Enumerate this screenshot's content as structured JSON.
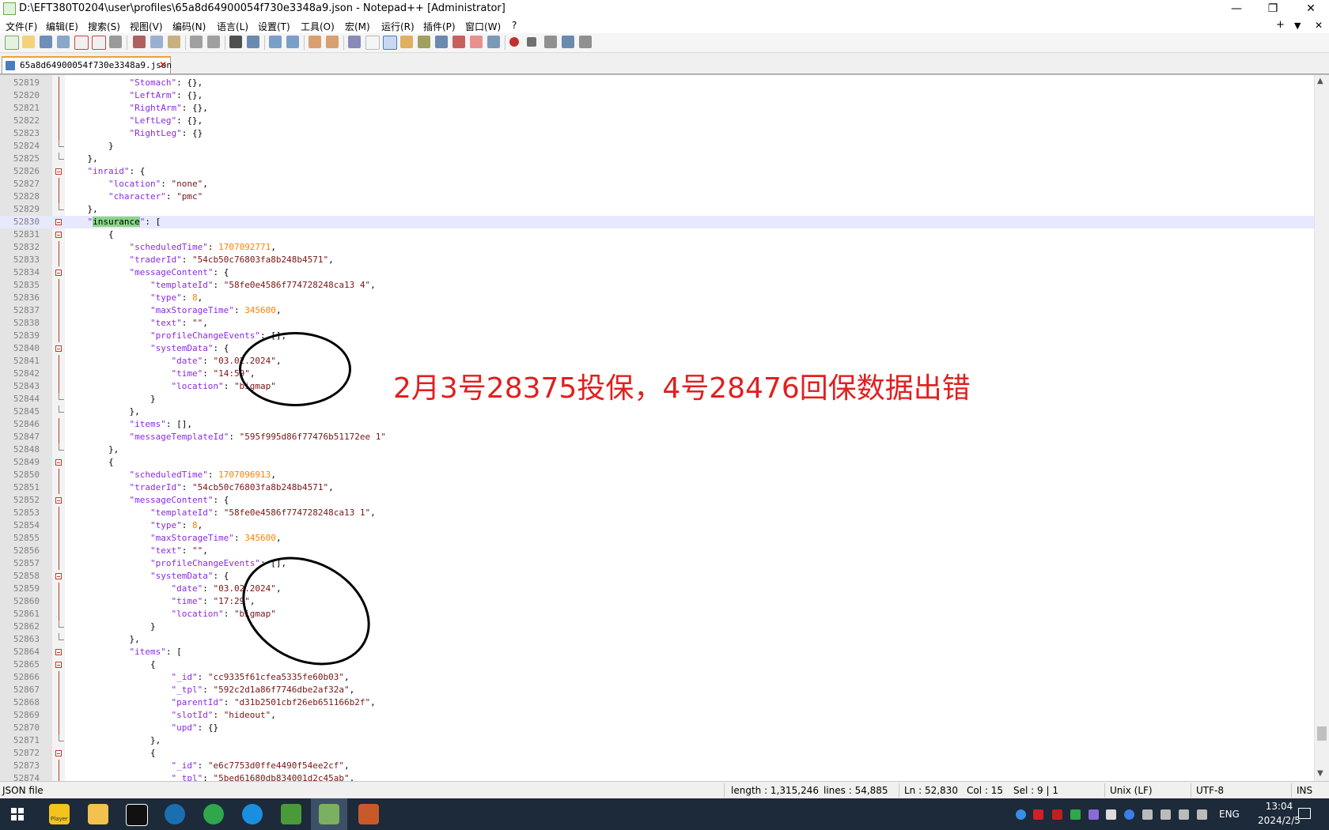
{
  "window": {
    "title": "D:\\EFT380T0204\\user\\profiles\\65a8d64900054f730e3348a9.json - Notepad++ [Administrator]",
    "min_glyph": "—",
    "restore_glyph": "❐",
    "close_glyph": "✕"
  },
  "menu": {
    "items": [
      "文件(F)",
      "编辑(E)",
      "搜索(S)",
      "视图(V)",
      "编码(N)",
      "语言(L)",
      "设置(T)",
      "工具(O)",
      "宏(M)",
      "运行(R)",
      "插件(P)",
      "窗口(W)",
      "?"
    ],
    "right": [
      "+",
      "▼",
      "✕"
    ]
  },
  "tab": {
    "label": "65a8d64900054f730e3348a9.json",
    "close": "✕"
  },
  "annotation": "2月3号28375投保，4号28476回保数据出错",
  "editor": {
    "current_line": 52830,
    "lines": [
      {
        "n": "52819",
        "i": 3,
        "t": [
          [
            "k",
            "\"Stomach\""
          ],
          [
            "p",
            ": {},"
          ]
        ]
      },
      {
        "n": "52820",
        "i": 3,
        "t": [
          [
            "k",
            "\"LeftArm\""
          ],
          [
            "p",
            ": {},"
          ]
        ]
      },
      {
        "n": "52821",
        "i": 3,
        "t": [
          [
            "k",
            "\"RightArm\""
          ],
          [
            "p",
            ": {},"
          ]
        ]
      },
      {
        "n": "52822",
        "i": 3,
        "t": [
          [
            "k",
            "\"LeftLeg\""
          ],
          [
            "p",
            ": {},"
          ]
        ]
      },
      {
        "n": "52823",
        "i": 3,
        "t": [
          [
            "k",
            "\"RightLeg\""
          ],
          [
            "p",
            ": {}"
          ]
        ]
      },
      {
        "n": "52824",
        "i": 2,
        "t": [
          [
            "p",
            "}"
          ]
        ],
        "fold": "end"
      },
      {
        "n": "52825",
        "i": 1,
        "t": [
          [
            "p",
            "},"
          ]
        ],
        "fold": "end"
      },
      {
        "n": "52826",
        "i": 1,
        "t": [
          [
            "k",
            "\"inraid\""
          ],
          [
            "p",
            ": {"
          ]
        ],
        "fold": "open"
      },
      {
        "n": "52827",
        "i": 2,
        "t": [
          [
            "k",
            "\"location\""
          ],
          [
            "p",
            ": "
          ],
          [
            "s",
            "\"none\""
          ],
          [
            "p",
            ","
          ]
        ]
      },
      {
        "n": "52828",
        "i": 2,
        "t": [
          [
            "k",
            "\"character\""
          ],
          [
            "p",
            ": "
          ],
          [
            "s",
            "\"pmc\""
          ]
        ]
      },
      {
        "n": "52829",
        "i": 1,
        "t": [
          [
            "p",
            "},"
          ]
        ],
        "fold": "end"
      },
      {
        "n": "52830",
        "i": 1,
        "t": [
          [
            "k",
            "\""
          ],
          [
            "h",
            "insurance"
          ],
          [
            "k",
            "\""
          ],
          [
            "p",
            ": ["
          ]
        ],
        "fold": "open"
      },
      {
        "n": "52831",
        "i": 2,
        "t": [
          [
            "p",
            "{"
          ]
        ],
        "fold": "open"
      },
      {
        "n": "52832",
        "i": 3,
        "t": [
          [
            "k",
            "\"scheduledTime\""
          ],
          [
            "p",
            ": "
          ],
          [
            "n",
            "1707092771"
          ],
          [
            "p",
            ","
          ]
        ]
      },
      {
        "n": "52833",
        "i": 3,
        "t": [
          [
            "k",
            "\"traderId\""
          ],
          [
            "p",
            ": "
          ],
          [
            "s",
            "\"54cb50c76803fa8b248b4571\""
          ],
          [
            "p",
            ","
          ]
        ]
      },
      {
        "n": "52834",
        "i": 3,
        "t": [
          [
            "k",
            "\"messageContent\""
          ],
          [
            "p",
            ": {"
          ]
        ],
        "fold": "open"
      },
      {
        "n": "52835",
        "i": 4,
        "t": [
          [
            "k",
            "\"templateId\""
          ],
          [
            "p",
            ": "
          ],
          [
            "s",
            "\"58fe0e4586f774728248ca13 4\""
          ],
          [
            "p",
            ","
          ]
        ]
      },
      {
        "n": "52836",
        "i": 4,
        "t": [
          [
            "k",
            "\"type\""
          ],
          [
            "p",
            ": "
          ],
          [
            "n",
            "8"
          ],
          [
            "p",
            ","
          ]
        ]
      },
      {
        "n": "52837",
        "i": 4,
        "t": [
          [
            "k",
            "\"maxStorageTime\""
          ],
          [
            "p",
            ": "
          ],
          [
            "n",
            "345600"
          ],
          [
            "p",
            ","
          ]
        ]
      },
      {
        "n": "52838",
        "i": 4,
        "t": [
          [
            "k",
            "\"text\""
          ],
          [
            "p",
            ": "
          ],
          [
            "s",
            "\"\""
          ],
          [
            "p",
            ","
          ]
        ]
      },
      {
        "n": "52839",
        "i": 4,
        "t": [
          [
            "k",
            "\"profileChangeEvents\""
          ],
          [
            "p",
            ": [],"
          ]
        ]
      },
      {
        "n": "52840",
        "i": 4,
        "t": [
          [
            "k",
            "\"systemData\""
          ],
          [
            "p",
            ": {"
          ]
        ],
        "fold": "open"
      },
      {
        "n": "52841",
        "i": 5,
        "t": [
          [
            "k",
            "\"date\""
          ],
          [
            "p",
            ": "
          ],
          [
            "s",
            "\"03.02.2024\""
          ],
          [
            "p",
            ","
          ]
        ]
      },
      {
        "n": "52842",
        "i": 5,
        "t": [
          [
            "k",
            "\"time\""
          ],
          [
            "p",
            ": "
          ],
          [
            "s",
            "\"14:59\""
          ],
          [
            "p",
            ","
          ]
        ]
      },
      {
        "n": "52843",
        "i": 5,
        "t": [
          [
            "k",
            "\"location\""
          ],
          [
            "p",
            ": "
          ],
          [
            "s",
            "\"bigmap\""
          ]
        ]
      },
      {
        "n": "52844",
        "i": 4,
        "t": [
          [
            "p",
            "}"
          ]
        ],
        "fold": "end"
      },
      {
        "n": "52845",
        "i": 3,
        "t": [
          [
            "p",
            "},"
          ]
        ],
        "fold": "end"
      },
      {
        "n": "52846",
        "i": 3,
        "t": [
          [
            "k",
            "\"items\""
          ],
          [
            "p",
            ": [],"
          ]
        ]
      },
      {
        "n": "52847",
        "i": 3,
        "t": [
          [
            "k",
            "\"messageTemplateId\""
          ],
          [
            "p",
            ": "
          ],
          [
            "s",
            "\"595f995d86f77476b51172ee 1\""
          ]
        ]
      },
      {
        "n": "52848",
        "i": 2,
        "t": [
          [
            "p",
            "},"
          ]
        ],
        "fold": "end"
      },
      {
        "n": "52849",
        "i": 2,
        "t": [
          [
            "p",
            "{"
          ]
        ],
        "fold": "open"
      },
      {
        "n": "52850",
        "i": 3,
        "t": [
          [
            "k",
            "\"scheduledTime\""
          ],
          [
            "p",
            ": "
          ],
          [
            "n",
            "1707096913"
          ],
          [
            "p",
            ","
          ]
        ]
      },
      {
        "n": "52851",
        "i": 3,
        "t": [
          [
            "k",
            "\"traderId\""
          ],
          [
            "p",
            ": "
          ],
          [
            "s",
            "\"54cb50c76803fa8b248b4571\""
          ],
          [
            "p",
            ","
          ]
        ]
      },
      {
        "n": "52852",
        "i": 3,
        "t": [
          [
            "k",
            "\"messageContent\""
          ],
          [
            "p",
            ": {"
          ]
        ],
        "fold": "open"
      },
      {
        "n": "52853",
        "i": 4,
        "t": [
          [
            "k",
            "\"templateId\""
          ],
          [
            "p",
            ": "
          ],
          [
            "s",
            "\"58fe0e4586f774728248ca13 1\""
          ],
          [
            "p",
            ","
          ]
        ]
      },
      {
        "n": "52854",
        "i": 4,
        "t": [
          [
            "k",
            "\"type\""
          ],
          [
            "p",
            ": "
          ],
          [
            "n",
            "8"
          ],
          [
            "p",
            ","
          ]
        ]
      },
      {
        "n": "52855",
        "i": 4,
        "t": [
          [
            "k",
            "\"maxStorageTime\""
          ],
          [
            "p",
            ": "
          ],
          [
            "n",
            "345600"
          ],
          [
            "p",
            ","
          ]
        ]
      },
      {
        "n": "52856",
        "i": 4,
        "t": [
          [
            "k",
            "\"text\""
          ],
          [
            "p",
            ": "
          ],
          [
            "s",
            "\"\""
          ],
          [
            "p",
            ","
          ]
        ]
      },
      {
        "n": "52857",
        "i": 4,
        "t": [
          [
            "k",
            "\"profileChangeEvents\""
          ],
          [
            "p",
            ": [],"
          ]
        ]
      },
      {
        "n": "52858",
        "i": 4,
        "t": [
          [
            "k",
            "\"systemData\""
          ],
          [
            "p",
            ": {"
          ]
        ],
        "fold": "open"
      },
      {
        "n": "52859",
        "i": 5,
        "t": [
          [
            "k",
            "\"date\""
          ],
          [
            "p",
            ": "
          ],
          [
            "s",
            "\"03.02.2024\""
          ],
          [
            "p",
            ","
          ]
        ]
      },
      {
        "n": "52860",
        "i": 5,
        "t": [
          [
            "k",
            "\"time\""
          ],
          [
            "p",
            ": "
          ],
          [
            "s",
            "\"17:29\""
          ],
          [
            "p",
            ","
          ]
        ]
      },
      {
        "n": "52861",
        "i": 5,
        "t": [
          [
            "k",
            "\"location\""
          ],
          [
            "p",
            ": "
          ],
          [
            "s",
            "\"bigmap\""
          ]
        ]
      },
      {
        "n": "52862",
        "i": 4,
        "t": [
          [
            "p",
            "}"
          ]
        ],
        "fold": "end"
      },
      {
        "n": "52863",
        "i": 3,
        "t": [
          [
            "p",
            "},"
          ]
        ],
        "fold": "end"
      },
      {
        "n": "52864",
        "i": 3,
        "t": [
          [
            "k",
            "\"items\""
          ],
          [
            "p",
            ": ["
          ]
        ],
        "fold": "open"
      },
      {
        "n": "52865",
        "i": 4,
        "t": [
          [
            "p",
            "{"
          ]
        ],
        "fold": "open"
      },
      {
        "n": "52866",
        "i": 5,
        "t": [
          [
            "k",
            "\"_id\""
          ],
          [
            "p",
            ": "
          ],
          [
            "s",
            "\"cc9335f61cfea5335fe60b03\""
          ],
          [
            "p",
            ","
          ]
        ]
      },
      {
        "n": "52867",
        "i": 5,
        "t": [
          [
            "k",
            "\"_tpl\""
          ],
          [
            "p",
            ": "
          ],
          [
            "s",
            "\"592c2d1a86f7746dbe2af32a\""
          ],
          [
            "p",
            ","
          ]
        ]
      },
      {
        "n": "52868",
        "i": 5,
        "t": [
          [
            "k",
            "\"parentId\""
          ],
          [
            "p",
            ": "
          ],
          [
            "s",
            "\"d31b2501cbf26eb651166b2f\""
          ],
          [
            "p",
            ","
          ]
        ]
      },
      {
        "n": "52869",
        "i": 5,
        "t": [
          [
            "k",
            "\"slotId\""
          ],
          [
            "p",
            ": "
          ],
          [
            "s",
            "\"hideout\""
          ],
          [
            "p",
            ","
          ]
        ]
      },
      {
        "n": "52870",
        "i": 5,
        "t": [
          [
            "k",
            "\"upd\""
          ],
          [
            "p",
            ": {}"
          ]
        ]
      },
      {
        "n": "52871",
        "i": 4,
        "t": [
          [
            "p",
            "},"
          ]
        ],
        "fold": "end"
      },
      {
        "n": "52872",
        "i": 4,
        "t": [
          [
            "p",
            "{"
          ]
        ],
        "fold": "open"
      },
      {
        "n": "52873",
        "i": 5,
        "t": [
          [
            "k",
            "\"_id\""
          ],
          [
            "p",
            ": "
          ],
          [
            "s",
            "\"e6c7753d0ffe4490f54ee2cf\""
          ],
          [
            "p",
            ","
          ]
        ]
      },
      {
        "n": "52874",
        "i": 5,
        "t": [
          [
            "k",
            "\"_tpl\""
          ],
          [
            "p",
            ": "
          ],
          [
            "s",
            "\"5bed61680db834001d2c45ab\""
          ],
          [
            "p",
            ","
          ]
        ]
      }
    ]
  },
  "status": {
    "file_type": "JSON file",
    "length": "length : 1,315,246",
    "lines": "lines : 54,885",
    "ln": "Ln : 52,830",
    "col": "Col : 15",
    "sel": "Sel : 9 | 1",
    "eol": "Unix (LF)",
    "encoding": "UTF-8",
    "mode": "INS"
  },
  "taskbar": {
    "player_label": "Player",
    "tray_lang": "ENG",
    "time": "13:04",
    "date": "2024/2/5"
  },
  "colors": {
    "keyword": "#8a2be2",
    "string": "#7a1515",
    "number": "#ff8000",
    "annotation": "#e02020",
    "highlight": "#8ad58a"
  }
}
